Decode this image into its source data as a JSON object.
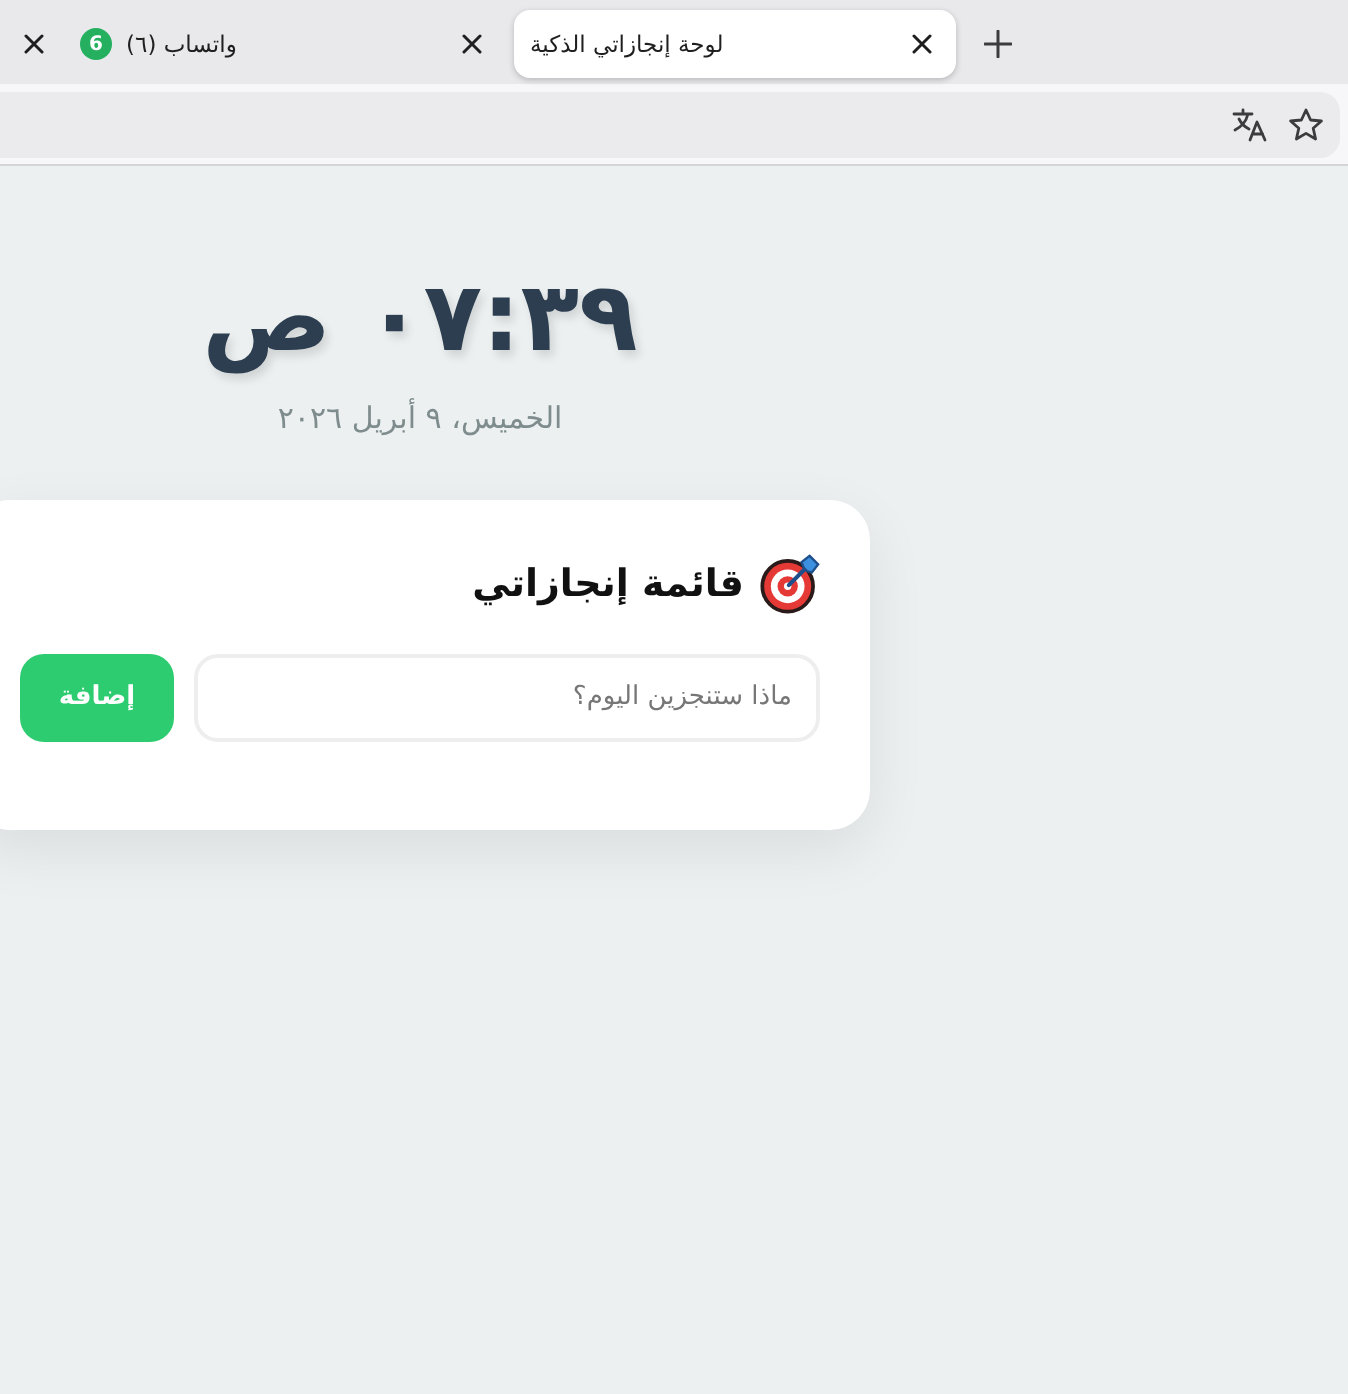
{
  "browser": {
    "tabs": [
      {
        "title": "لوحة إنجازاتي الذكية",
        "selected": true
      },
      {
        "title": "واتساب (٦)",
        "badge": "6",
        "selected": false
      },
      {
        "selected": false
      }
    ]
  },
  "page": {
    "clock": {
      "time": "٠٧:٣٩ ص",
      "date": "الخميس، ٩ أبريل ٢٠٢٦"
    },
    "card": {
      "title": "قائمة إنجازاتي",
      "input": {
        "placeholder": "ماذا ستنجزين اليوم؟"
      },
      "button": "إضافة"
    }
  }
}
